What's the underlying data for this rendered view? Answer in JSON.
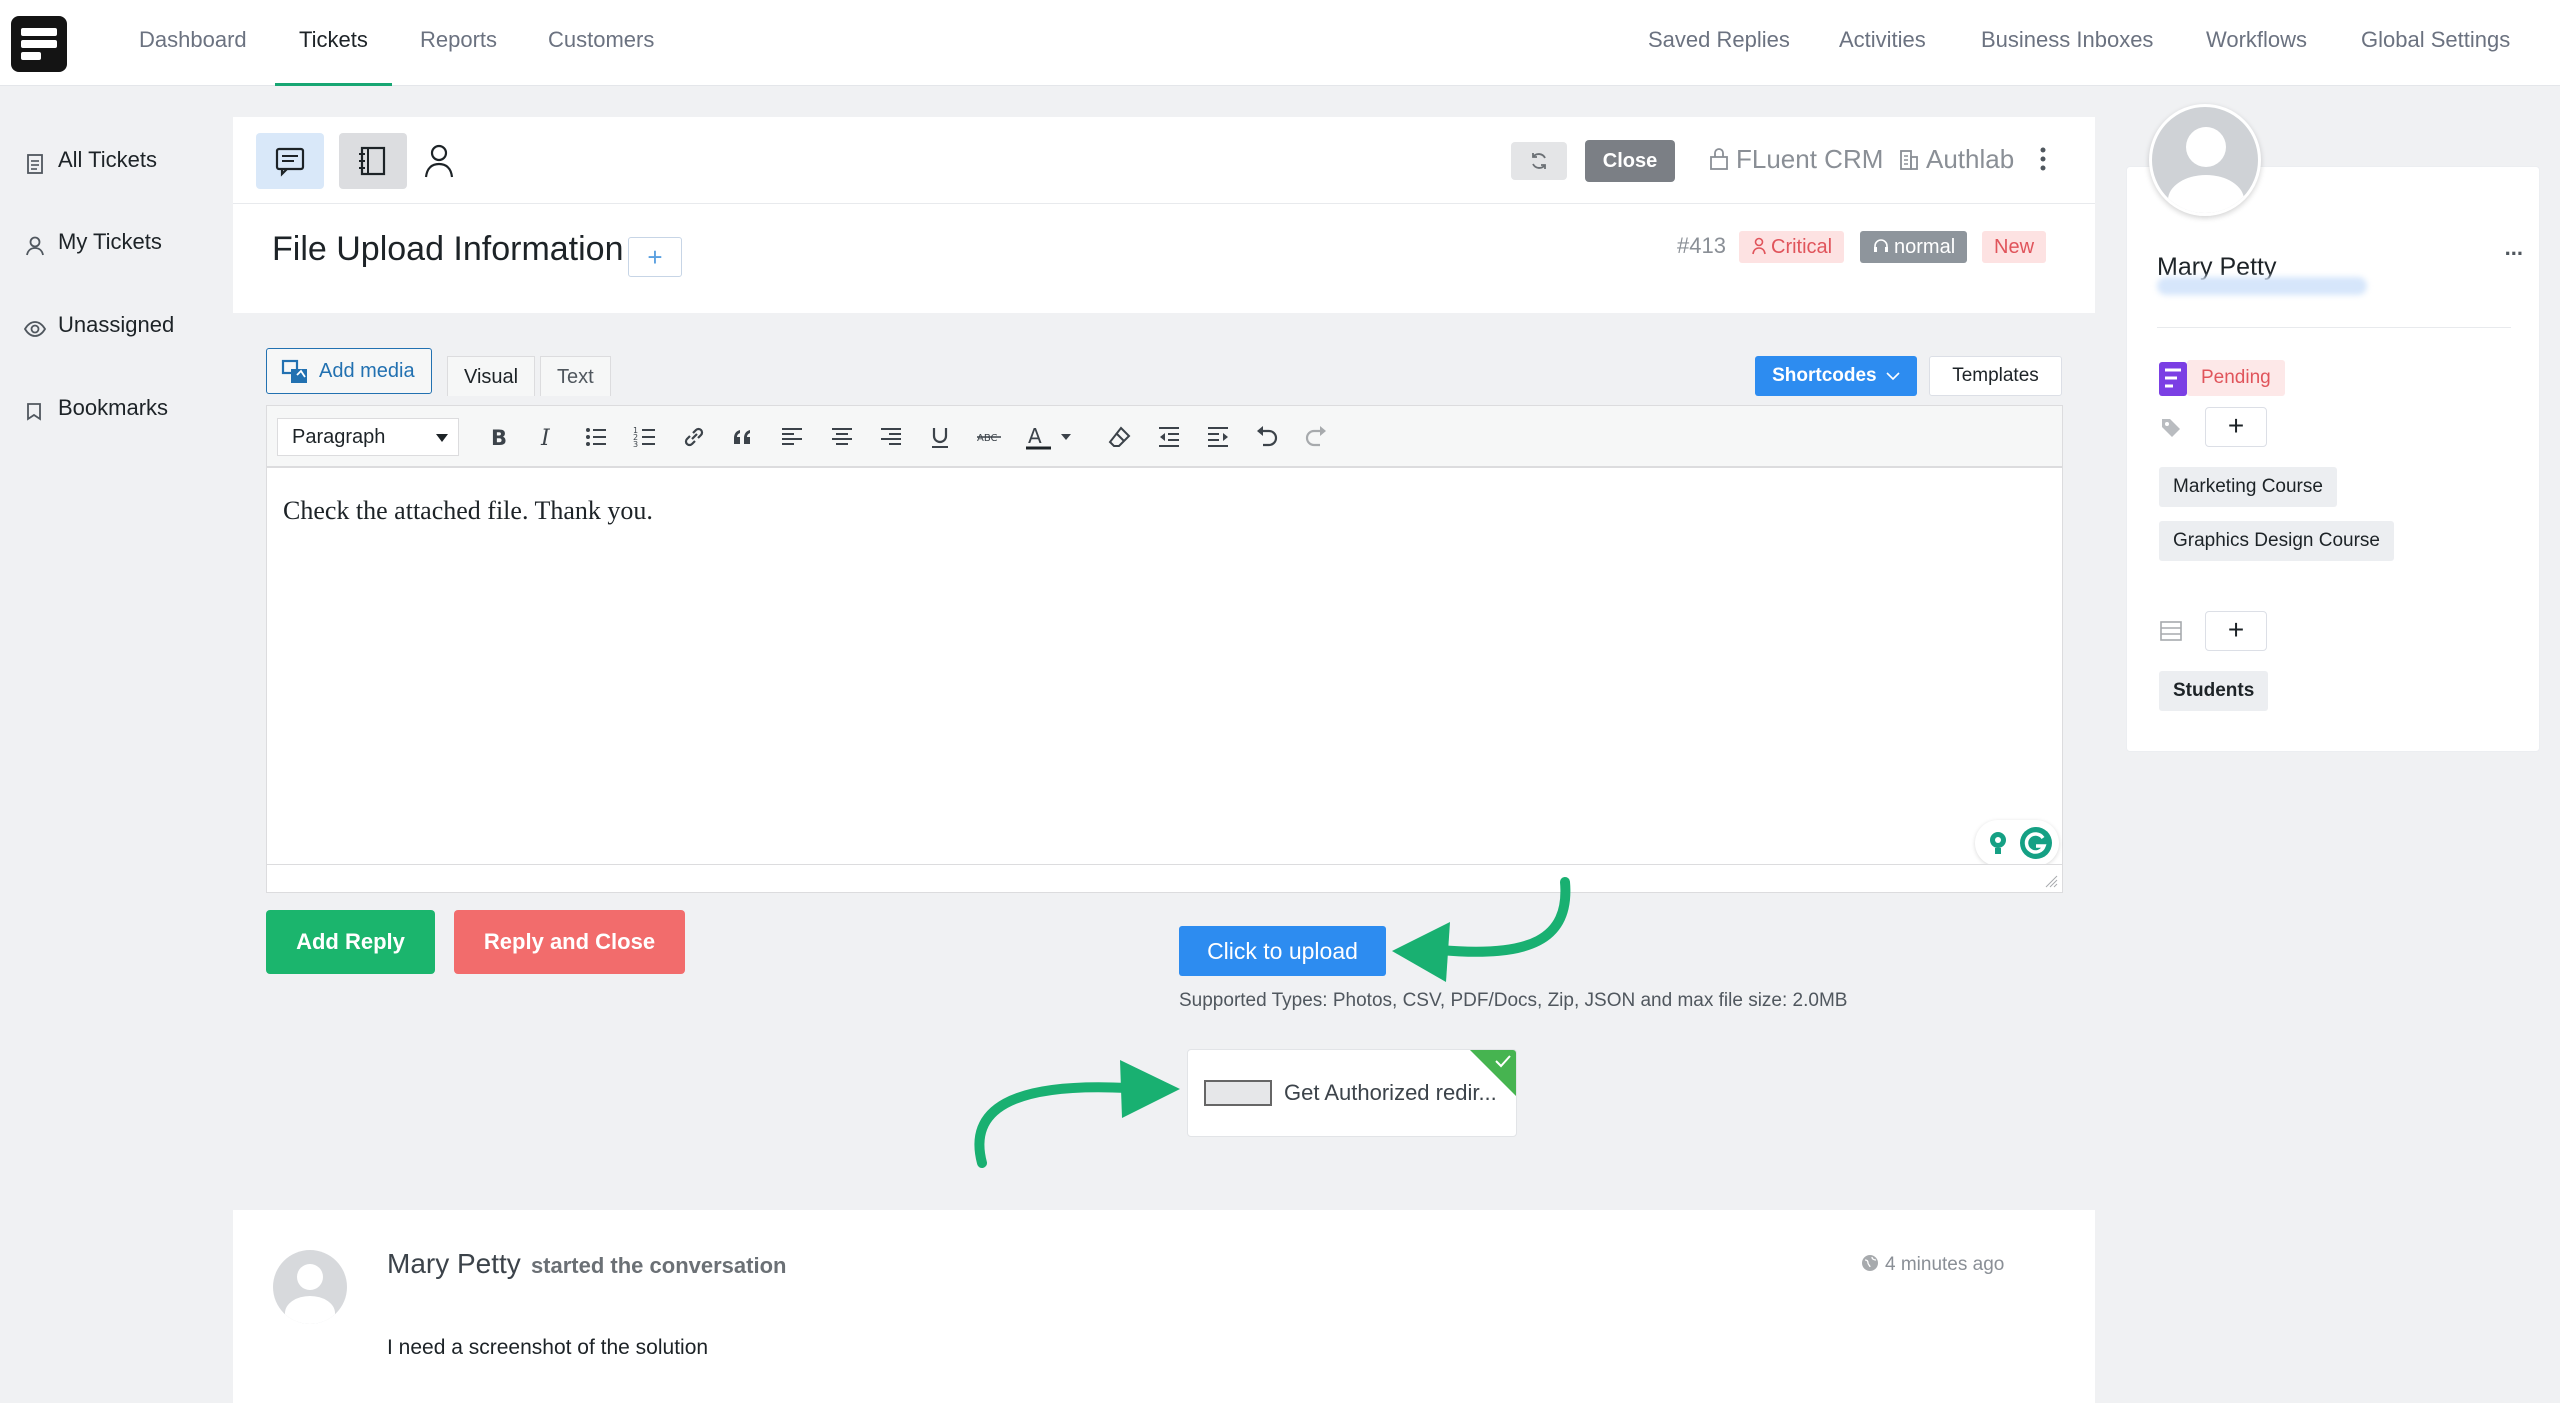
{
  "topnav": {
    "left": [
      "Dashboard",
      "Tickets",
      "Reports",
      "Customers"
    ],
    "right": [
      "Saved Replies",
      "Activities",
      "Business Inboxes",
      "Workflows",
      "Global Settings"
    ]
  },
  "sidebar": {
    "items": [
      {
        "label": "All Tickets",
        "icon": "document-icon"
      },
      {
        "label": "My Tickets",
        "icon": "user-icon"
      },
      {
        "label": "Unassigned",
        "icon": "eye-icon"
      },
      {
        "label": "Bookmarks",
        "icon": "bookmark-icon"
      }
    ]
  },
  "ticket": {
    "close_label": "Close",
    "crm_label": "FLuent CRM",
    "company_label": "Authlab",
    "title": "File Upload Information",
    "plus": "+",
    "number": "#413",
    "badges": {
      "priority": "Critical",
      "client_priority": "normal",
      "status": "New"
    }
  },
  "editor": {
    "add_media": "Add media",
    "tab_visual": "Visual",
    "tab_text": "Text",
    "shortcodes": "Shortcodes",
    "templates": "Templates",
    "format": "Paragraph",
    "content": "Check the attached file. Thank you."
  },
  "actions": {
    "add_reply": "Add Reply",
    "reply_close": "Reply and Close",
    "upload": "Click to upload",
    "supported": "Supported Types: Photos, CSV, PDF/Docs, Zip, JSON and max file size: 2.0MB",
    "file_name": "Get Authorized redir..."
  },
  "conversation": {
    "author": "Mary Petty",
    "action": "started the conversation",
    "time": "4 minutes ago",
    "message": "I need a screenshot of the solution"
  },
  "customer": {
    "name": "Mary Petty",
    "more": "...",
    "pending": "Pending",
    "products": [
      "Marketing Course",
      "Graphics Design Course"
    ],
    "plus": "+",
    "lists": [
      "Students"
    ]
  },
  "colors": {
    "accent": "#17a673",
    "blue": "#2d8cf0",
    "add_reply": "#1bb56d",
    "reply_close": "#f26c6c",
    "critical_bg": "#fde2e2",
    "critical_text": "#e0545b",
    "normal_bg": "#8e959c",
    "new_bg": "#fde2e2"
  }
}
